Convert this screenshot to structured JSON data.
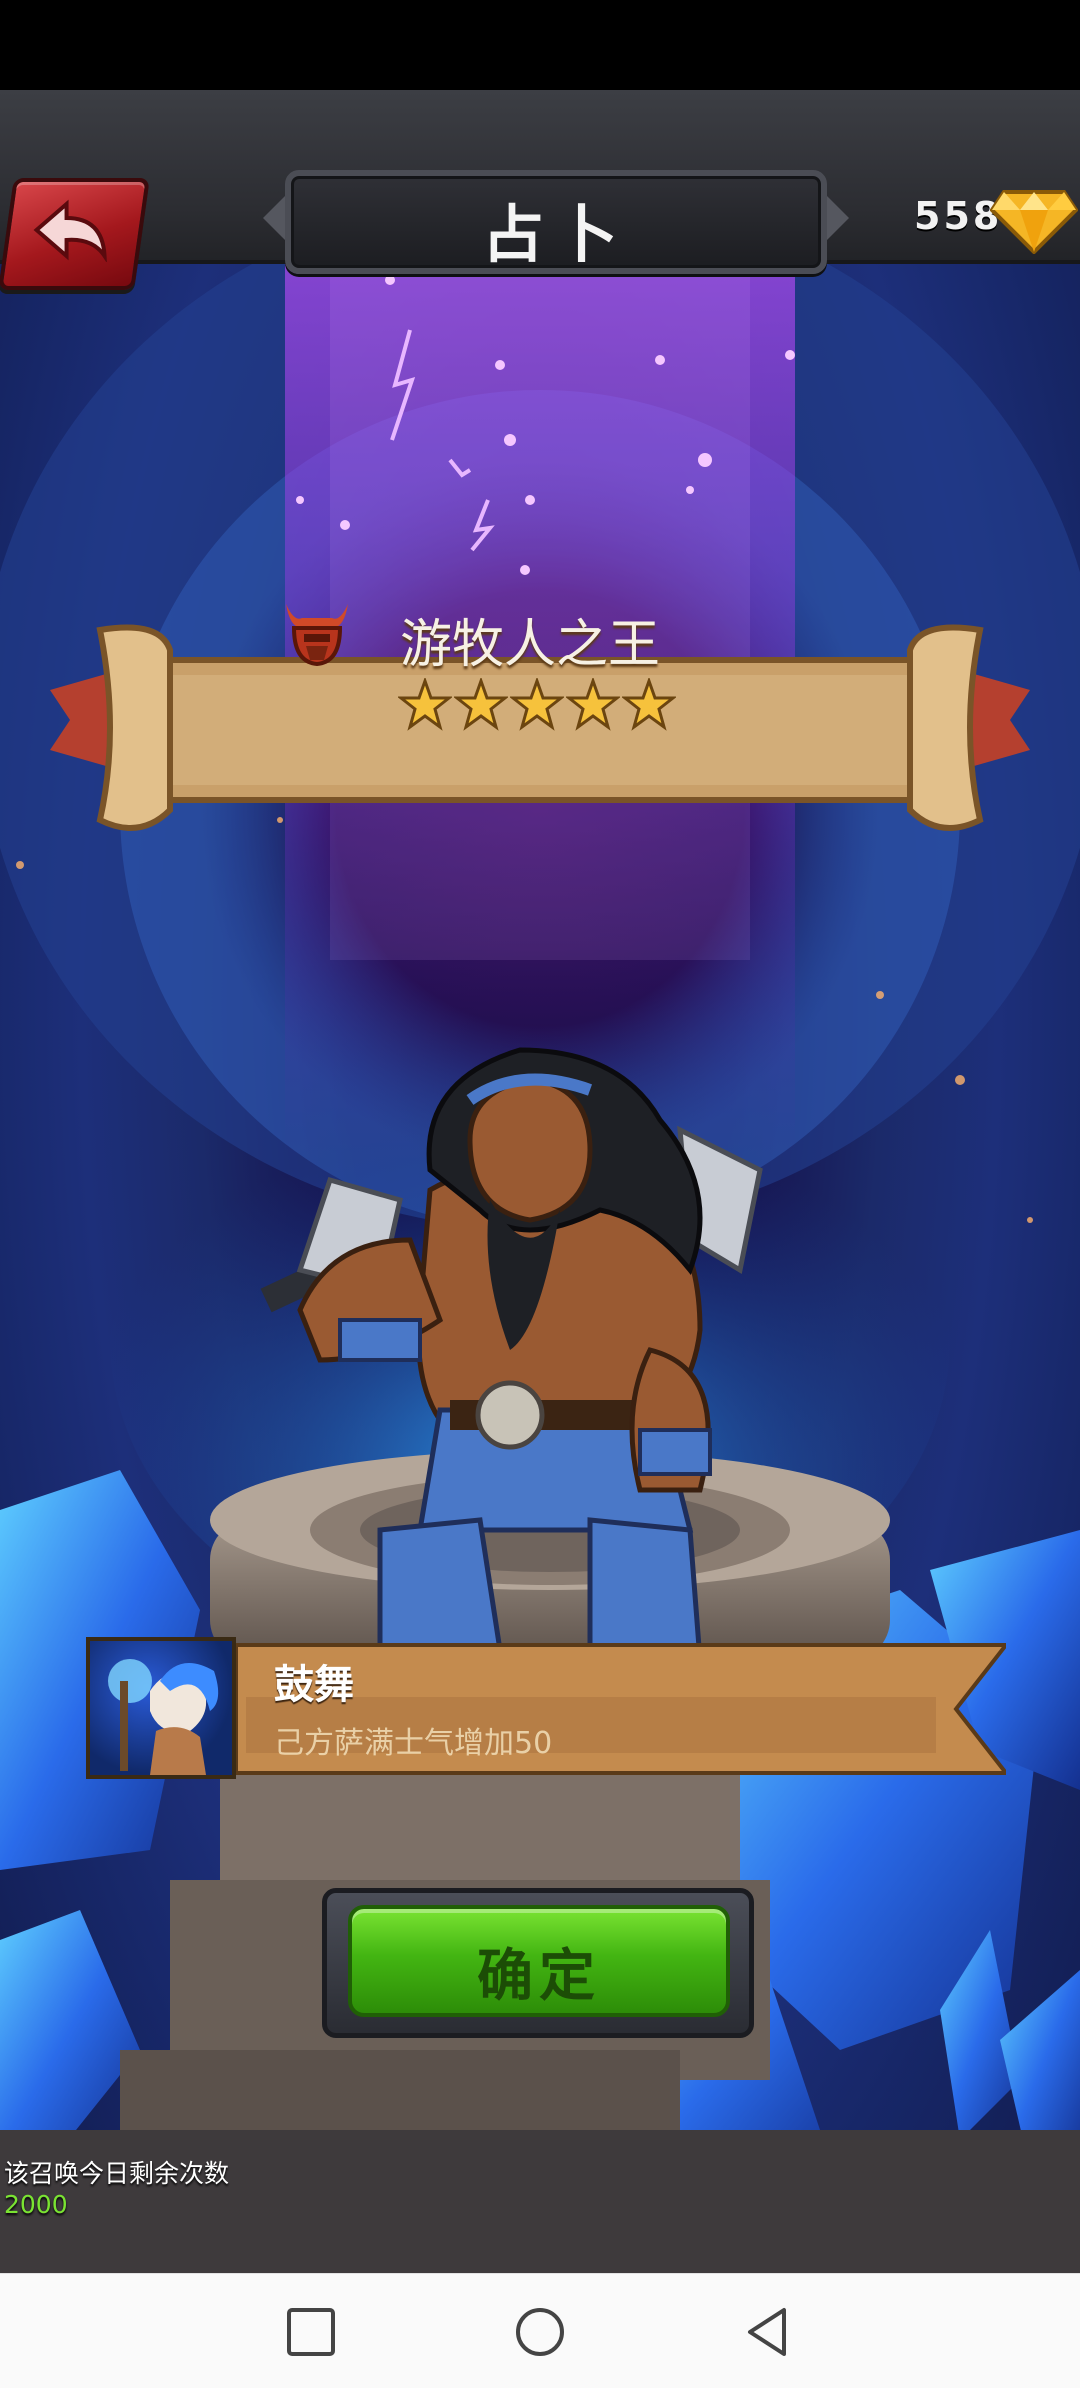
{
  "header": {
    "title": "占卜",
    "gem_count": "558",
    "back_icon": "back-arrow-icon",
    "gem_icon": "gem-icon"
  },
  "hero": {
    "name": "游牧人之王",
    "stars": 5
  },
  "skill": {
    "name": "鼓舞",
    "description": "己方萨满士气增加50"
  },
  "confirm": {
    "label": "确定"
  },
  "summon": {
    "label": "该召唤今日剩余次数",
    "count": "2000"
  },
  "nav": {
    "recents_icon": "square-icon",
    "home_icon": "circle-icon",
    "back_icon": "triangle-back-icon"
  },
  "colors": {
    "accent_green": "#43b512",
    "gem_gold": "#f5b625",
    "back_red": "#b0191e",
    "magic_purple": "#a33cff"
  }
}
